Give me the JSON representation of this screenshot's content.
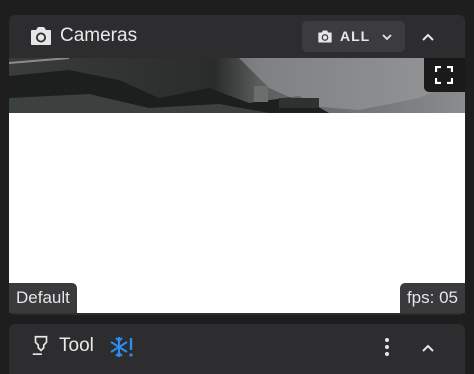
{
  "cameras_panel": {
    "title": "Cameras",
    "filter_label": "ALL",
    "icons": {
      "camera": "camera-icon",
      "chevron": "chevron-down-icon",
      "collapse": "chevron-up-icon",
      "fullscreen": "fullscreen-icon"
    },
    "feed": {
      "name_label": "Default",
      "fps_label": "fps: 05"
    }
  },
  "tool_panel": {
    "title": "Tool",
    "icons": {
      "tool": "nozzle-icon",
      "status": "snowflake-alert-icon",
      "menu": "more-vertical-icon",
      "collapse": "chevron-up-icon"
    }
  },
  "colors": {
    "background": "#1e1e1e",
    "panel": "#2d2d2f",
    "button": "#3c3c40",
    "accent_blue": "#2d8cf0"
  }
}
